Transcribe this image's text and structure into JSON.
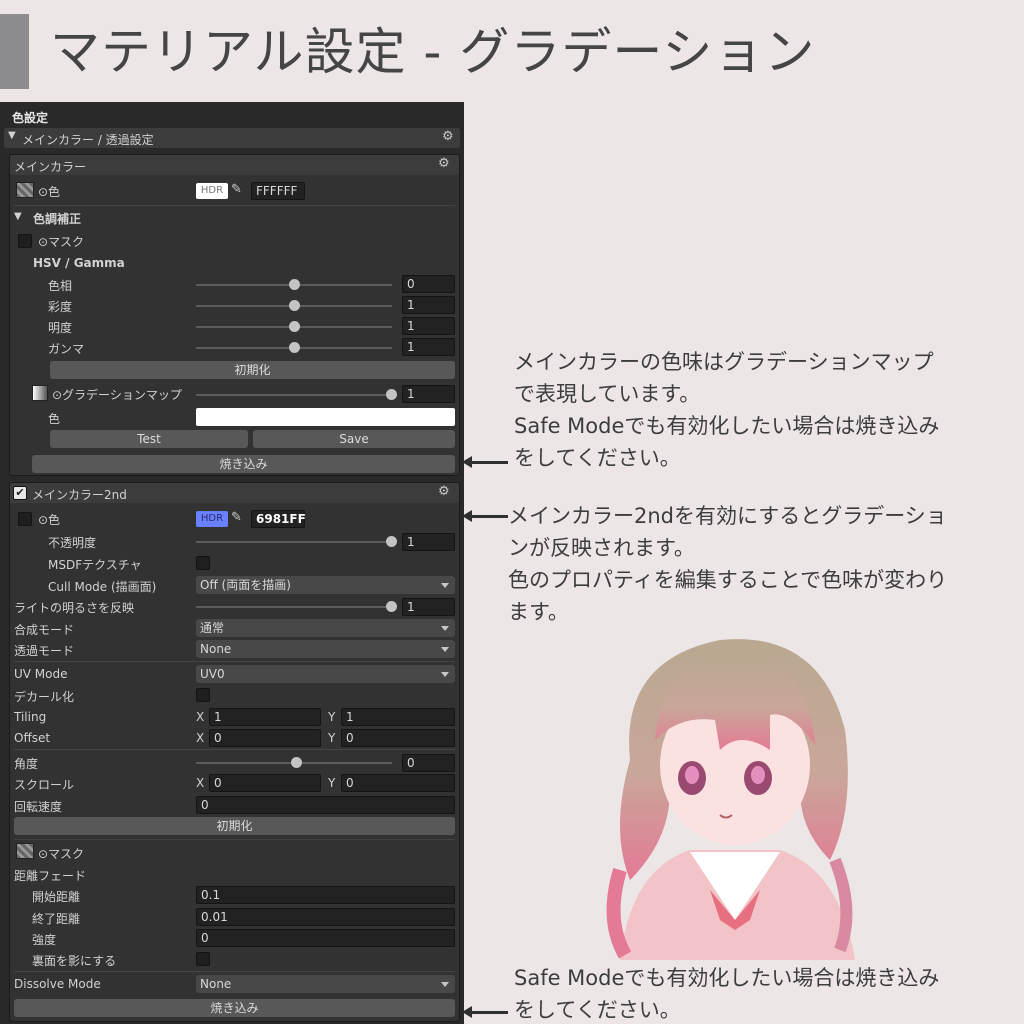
{
  "title": "マテリアル設定 - グラデーション",
  "panel": {
    "section_title": "色設定",
    "foldout_label": "メインカラー / 透過設定",
    "main_color": {
      "header": "メインカラー",
      "color_label": "⊙色",
      "hdr": "HDR",
      "hex": "FFFFFF",
      "tone_label": "色調補正",
      "mask_label": "⊙マスク",
      "hsv_label": "HSV / Gamma",
      "sliders": [
        {
          "label": "色相",
          "value": "0",
          "level": 0.5
        },
        {
          "label": "彩度",
          "value": "1",
          "level": 0.5
        },
        {
          "label": "明度",
          "value": "1",
          "level": 0.5
        },
        {
          "label": "ガンマ",
          "value": "1",
          "level": 0.5
        }
      ],
      "reset_label": "初期化",
      "gradmap_label": "⊙グラデーションマップ",
      "gradmap_value": "1",
      "grad_color_label": "色",
      "test_label": "Test",
      "save_label": "Save",
      "bake_label": "焼き込み"
    },
    "main_color2": {
      "header": "メインカラー2nd",
      "enabled": true,
      "color_label": "⊙色",
      "hdr": "HDR",
      "hex": "6981FF",
      "rows": {
        "opacity_label": "不透明度",
        "opacity_value": "1",
        "msdf_label": "MSDFテクスチャ",
        "cull_label": "Cull Mode (描画面)",
        "cull_value": "Off (両面を描画)",
        "light_label": "ライトの明るさを反映",
        "light_value": "1",
        "blend_label": "合成モード",
        "blend_value": "通常",
        "alpha_label": "透過モード",
        "alpha_value": "None",
        "uv_label": "UV Mode",
        "uv_value": "UV0",
        "decal_label": "デカール化",
        "tiling_label": "Tiling",
        "tiling_x": "1",
        "tiling_y": "1",
        "offset_label": "Offset",
        "offset_x": "0",
        "offset_y": "0",
        "angle_label": "角度",
        "angle_value": "0",
        "scroll_label": "スクロール",
        "scroll_x": "0",
        "scroll_y": "0",
        "rotate_label": "回転速度",
        "rotate_value": "0",
        "reset_label": "初期化",
        "mask_label": "⊙マスク",
        "fade_label": "距離フェード",
        "fade_start_label": "開始距離",
        "fade_start": "0.1",
        "fade_end_label": "終了距離",
        "fade_end": "0.01",
        "strength_label": "強度",
        "strength": "0",
        "backface_label": "裏面を影にする",
        "dissolve_label": "Dissolve Mode",
        "dissolve_value": "None",
        "bake_label": "焼き込み",
        "x": "X",
        "y": "Y"
      }
    }
  },
  "notes": {
    "note1": [
      "メインカラーの色味はグラデーションマップ",
      "で表現しています。",
      "Safe Modeでも有効化したい場合は焼き込み",
      "をしてください。"
    ],
    "note2": [
      "メインカラー2ndを有効にするとグラデーショ",
      "ンが反映されます。",
      "色のプロパティを編集することで色味が変わり",
      "ます。"
    ],
    "note3": [
      "Safe Modeでも有効化したい場合は焼き込み",
      "をしてください。"
    ]
  },
  "colors": {
    "hdr2": "#6981ff",
    "grad_color": "#ffffff",
    "hair": "#b6a58e",
    "hair_pink": "#e07a92"
  }
}
